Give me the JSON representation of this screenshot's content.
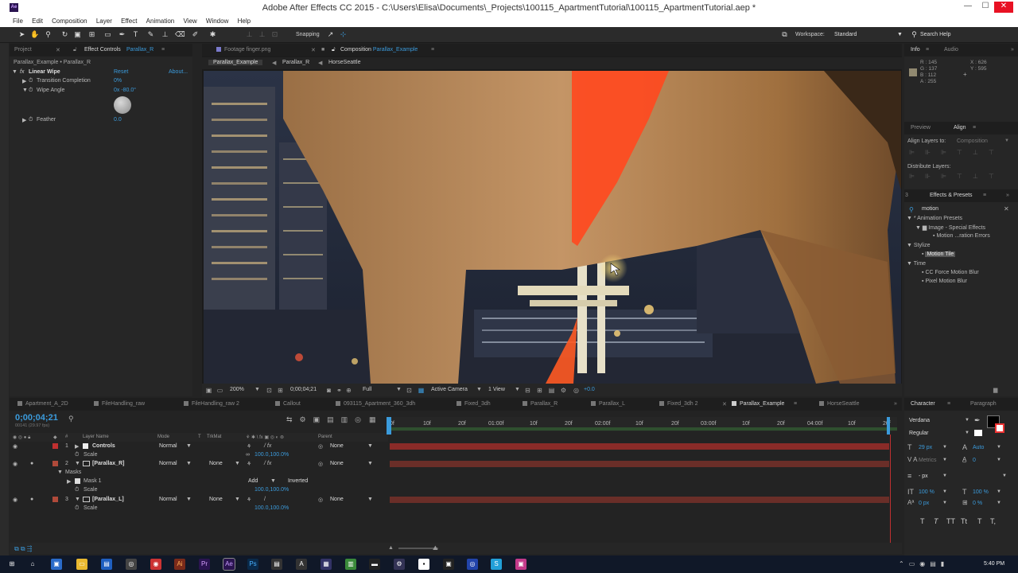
{
  "window": {
    "title": "Adobe After Effects CC 2015 - C:\\Users\\Elisa\\Documents\\_Projects\\100115_ApartmentTutorial\\100115_ApartmentTutorial.aep *",
    "app_icon": "Ae",
    "minimize": "—",
    "maximize": "☐",
    "close": "✕"
  },
  "menu": [
    "File",
    "Edit",
    "Composition",
    "Layer",
    "Effect",
    "Animation",
    "View",
    "Window",
    "Help"
  ],
  "toolbar": {
    "snapping": "Snapping",
    "workspace_label": "Workspace:",
    "workspace_value": "Standard",
    "search_help": "Search Help"
  },
  "effect_panel": {
    "tab_project": "Project",
    "tab_effect_controls": "Effect Controls",
    "tab_effect_target": "Parallax_R",
    "breadcrumb": "Parallax_Example • Parallax_R",
    "effect_name": "Linear Wipe",
    "reset": "Reset",
    "about": "About...",
    "transition_label": "Transition Completion",
    "transition_value": "0%",
    "angle_label": "Wipe Angle",
    "angle_value": "0x -80.0°",
    "feather_label": "Feather",
    "feather_value": "0.0"
  },
  "comp_panel": {
    "tab_footage": "Footage finger.png",
    "tab_composition": "Composition",
    "tab_comp_name": "Parallax_Example",
    "nav": [
      "Parallax_Example",
      "Parallax_R",
      "HorseSeattle"
    ],
    "zoom": "200%",
    "timecode": "0;00;04;21",
    "resolution": "Full",
    "camera": "Active Camera",
    "views": "1 View",
    "exposure": "+0.0"
  },
  "info_panel": {
    "tab_info": "Info",
    "tab_audio": "Audio",
    "r": "R : 145",
    "g": "G : 137",
    "b": "B : 112",
    "a": "A : 255",
    "x": "X : 626",
    "y": "Y : 595",
    "swatch_color": "#918970"
  },
  "align_panel": {
    "tab_preview": "Preview",
    "tab_align": "Align",
    "align_to_label": "Align Layers to:",
    "align_to_value": "Composition",
    "distribute_label": "Distribute Layers:"
  },
  "effects_presets": {
    "title": "Effects & Presets",
    "search": "motion",
    "items": [
      {
        "label": "* Animation Presets",
        "indent": 0
      },
      {
        "label": "Image - Special Effects",
        "indent": 1
      },
      {
        "label": "Motion ...ration Errors",
        "indent": 2
      },
      {
        "label": "Stylize",
        "indent": 0
      },
      {
        "label": "Motion Tile",
        "indent": 1,
        "selected": true
      },
      {
        "label": "Time",
        "indent": 0
      },
      {
        "label": "CC Force Motion Blur",
        "indent": 1
      },
      {
        "label": "Pixel Motion Blur",
        "indent": 1
      }
    ]
  },
  "timeline": {
    "tabs": [
      "Apartment_A_2D",
      "FileHandling_raw",
      "FileHandling_raw 2",
      "Callout",
      "093115_Apartment_360_3dh",
      "Fixed_3dh",
      "Parallax_R",
      "Parallax_L",
      "Fixed_3dh 2",
      "Parallax_Example",
      "HorseSeattle"
    ],
    "active_tab": "Parallax_Example",
    "timecode": "0;00;04;21",
    "fps": "00141 (29.97 fps)",
    "col_layer_name": "Layer Name",
    "col_mode": "Mode",
    "col_t": "T",
    "col_trkmat": "TrkMat",
    "col_parent": "Parent",
    "ruler": [
      "0f",
      "10f",
      "20f",
      "01:00f",
      "10f",
      "20f",
      "02:00f",
      "10f",
      "20f",
      "03:00f",
      "10f",
      "20f",
      "04:00f",
      "10f",
      "20f"
    ],
    "rows": [
      {
        "num": "1",
        "name": "Controls",
        "mode": "Normal",
        "trkmat": "",
        "parent": "None",
        "color": "#c03030",
        "kind": "layer"
      },
      {
        "name": "Scale",
        "value": "100.0,100.0%",
        "kind": "prop"
      },
      {
        "num": "2",
        "name": "[Parallax_R]",
        "mode": "Normal",
        "trkmat": "None",
        "parent": "None",
        "color": "#b04a3a",
        "kind": "layer"
      },
      {
        "name": "Masks",
        "kind": "group"
      },
      {
        "name": "Mask 1",
        "mask_mode": "Add",
        "mask_inverted": "Inverted",
        "kind": "mask"
      },
      {
        "name": "Scale",
        "value": "100.0,100.0%",
        "kind": "prop"
      },
      {
        "num": "3",
        "name": "[Parallax_L]",
        "mode": "Normal",
        "trkmat": "None",
        "parent": "None",
        "color": "#b04a3a",
        "kind": "layer"
      },
      {
        "name": "Scale",
        "value": "100.0,100.0%",
        "kind": "prop"
      }
    ]
  },
  "character": {
    "tab_character": "Character",
    "tab_paragraph": "Paragraph",
    "font": "Verdana",
    "style": "Regular",
    "size": "29 px",
    "leading": "Auto",
    "kerning": "Metrics",
    "tracking": "0",
    "stroke": "- px",
    "vscale": "100 %",
    "hscale": "100 %",
    "baseline": "0 px",
    "tsume": "0 %",
    "styles": [
      "T",
      "T",
      "TT",
      "Tt",
      "T",
      "T,"
    ]
  },
  "taskbar": {
    "time": "5:40 PM",
    "apps": [
      "Ai",
      "Pr",
      "Ae",
      "Ps",
      "S"
    ]
  },
  "colors": {
    "accent_blue": "#3b9bdc",
    "layer_red": "#c03030",
    "timeline_bar": "#6a2e28"
  }
}
